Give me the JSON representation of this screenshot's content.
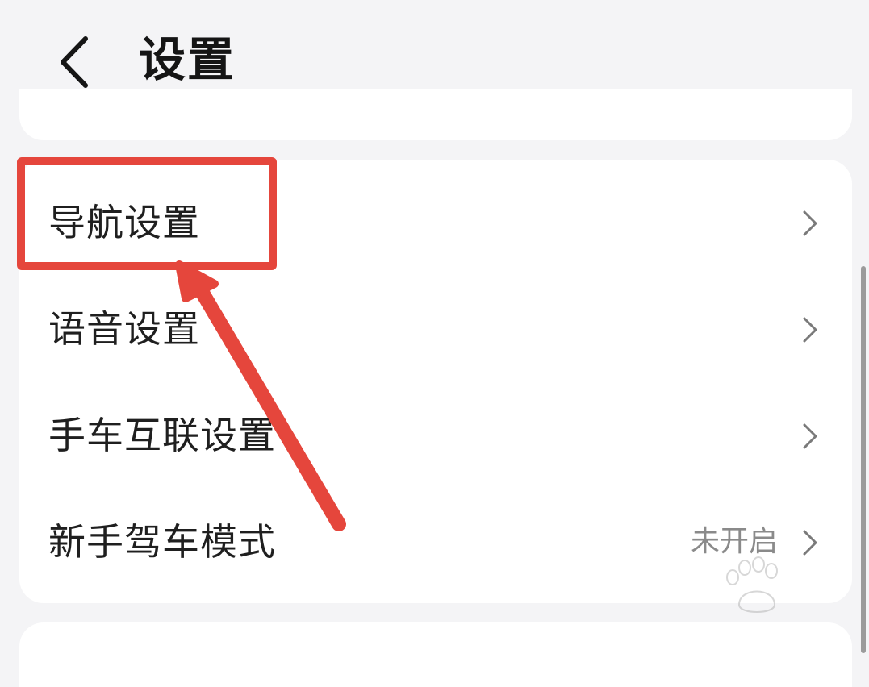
{
  "header": {
    "title": "设置",
    "back_icon": "chevron-left-icon"
  },
  "settings": {
    "items": [
      {
        "label": "导航设置",
        "value": "",
        "icon": "chevron-right-icon"
      },
      {
        "label": "语音设置",
        "value": "",
        "icon": "chevron-right-icon"
      },
      {
        "label": "手车互联设置",
        "value": "",
        "icon": "chevron-right-icon"
      },
      {
        "label": "新手驾车模式",
        "value": "未开启",
        "icon": "chevron-right-icon"
      }
    ]
  },
  "annotation": {
    "color": "#e5463c"
  },
  "colors": {
    "background": "#f4f4f6",
    "card": "#ffffff",
    "text": "#1f1f1f",
    "secondary_text": "#8a8a8a"
  }
}
